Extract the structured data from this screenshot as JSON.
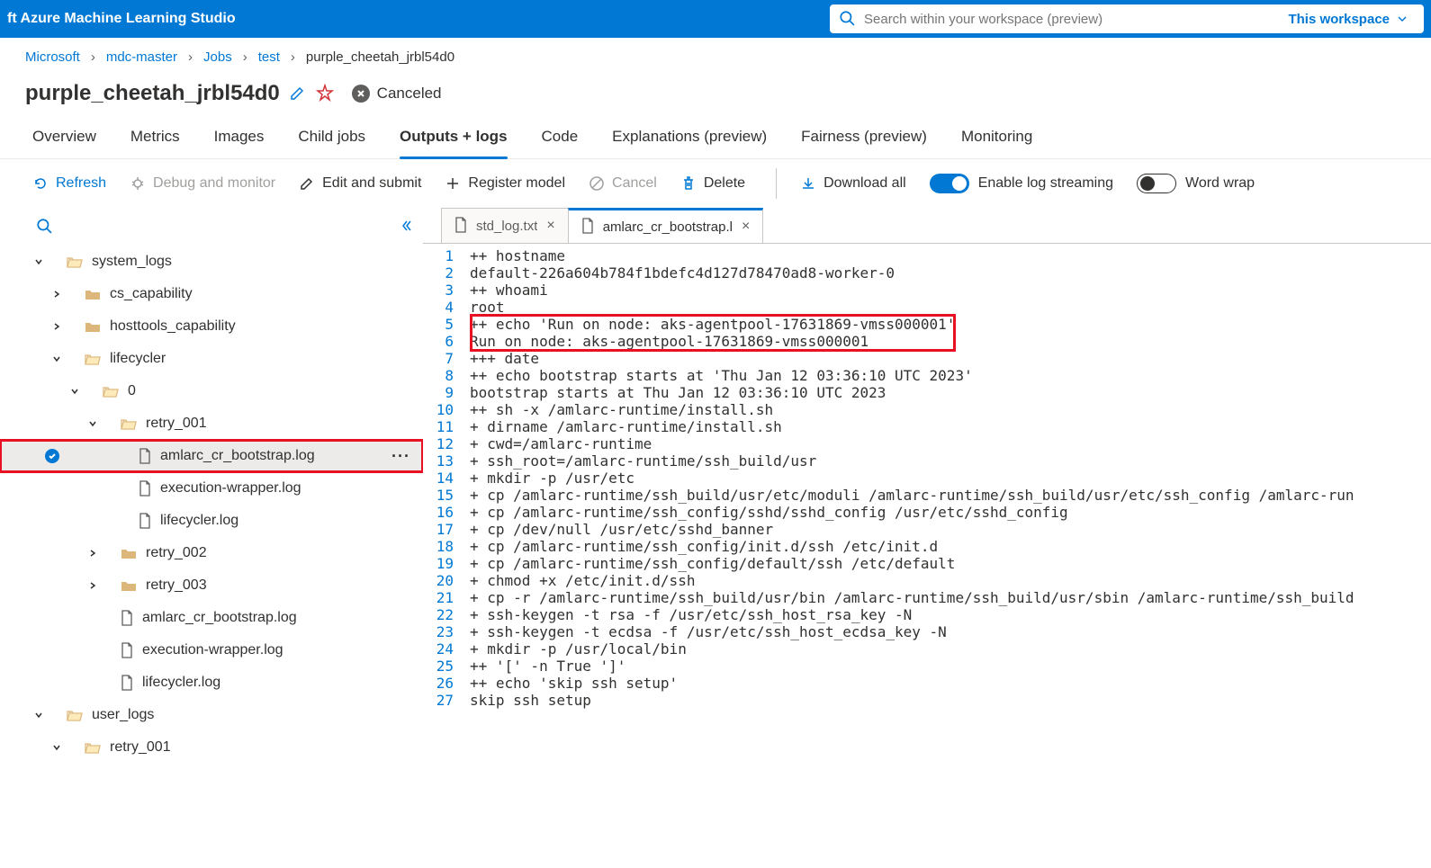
{
  "header": {
    "brand": "ft Azure Machine Learning Studio",
    "search_placeholder": "Search within your workspace (preview)",
    "search_scope": "This workspace"
  },
  "breadcrumbs": [
    "Microsoft",
    "mdc-master",
    "Jobs",
    "test",
    "purple_cheetah_jrbl54d0"
  ],
  "title": {
    "text": "purple_cheetah_jrbl54d0",
    "status": "Canceled"
  },
  "tabs": [
    "Overview",
    "Metrics",
    "Images",
    "Child jobs",
    "Outputs + logs",
    "Code",
    "Explanations (preview)",
    "Fairness (preview)",
    "Monitoring"
  ],
  "active_tab": 4,
  "toolbar": {
    "refresh": "Refresh",
    "debug": "Debug and monitor",
    "edit": "Edit and submit",
    "register": "Register model",
    "cancel": "Cancel",
    "delete": "Delete",
    "download_all": "Download all",
    "log_stream": "Enable log streaming",
    "word_wrap": "Word wrap"
  },
  "tree": {
    "system_logs": "system_logs",
    "cs_capability": "cs_capability",
    "hosttools_capability": "hosttools_capability",
    "lifecycler": "lifecycler",
    "zero": "0",
    "retry_001": "retry_001",
    "amlarc_log": "amlarc_cr_bootstrap.log",
    "exec_wrap": "execution-wrapper.log",
    "lifecycler_log": "lifecycler.log",
    "retry_002": "retry_002",
    "retry_003": "retry_003",
    "amlarc_log2": "amlarc_cr_bootstrap.log",
    "exec_wrap2": "execution-wrapper.log",
    "lifecycler_log2": "lifecycler.log",
    "user_logs": "user_logs",
    "retry_001b": "retry_001"
  },
  "editor": {
    "tabs": [
      {
        "label": "std_log.txt",
        "active": false
      },
      {
        "label": "amlarc_cr_bootstrap.l",
        "active": true
      }
    ],
    "lines": [
      "++ hostname",
      "default-226a604b784f1bdefc4d127d78470ad8-worker-0",
      "++ whoami",
      "root",
      "++ echo 'Run on node: aks-agentpool-17631869-vmss000001'",
      "Run on node: aks-agentpool-17631869-vmss000001",
      "+++ date",
      "++ echo bootstrap starts at 'Thu Jan 12 03:36:10 UTC 2023'",
      "bootstrap starts at Thu Jan 12 03:36:10 UTC 2023",
      "++ sh -x /amlarc-runtime/install.sh",
      "+ dirname /amlarc-runtime/install.sh",
      "+ cwd=/amlarc-runtime",
      "+ ssh_root=/amlarc-runtime/ssh_build/usr",
      "+ mkdir -p /usr/etc",
      "+ cp /amlarc-runtime/ssh_build/usr/etc/moduli /amlarc-runtime/ssh_build/usr/etc/ssh_config /amlarc-run",
      "+ cp /amlarc-runtime/ssh_config/sshd/sshd_config /usr/etc/sshd_config",
      "+ cp /dev/null /usr/etc/sshd_banner",
      "+ cp /amlarc-runtime/ssh_config/init.d/ssh /etc/init.d",
      "+ cp /amlarc-runtime/ssh_config/default/ssh /etc/default",
      "+ chmod +x /etc/init.d/ssh",
      "+ cp -r /amlarc-runtime/ssh_build/usr/bin /amlarc-runtime/ssh_build/usr/sbin /amlarc-runtime/ssh_build",
      "+ ssh-keygen -t rsa -f /usr/etc/ssh_host_rsa_key -N",
      "+ ssh-keygen -t ecdsa -f /usr/etc/ssh_host_ecdsa_key -N",
      "+ mkdir -p /usr/local/bin",
      "++ '[' -n True ']'",
      "++ echo 'skip ssh setup'",
      "skip ssh setup"
    ],
    "highlight_lines": [
      5,
      6
    ]
  }
}
